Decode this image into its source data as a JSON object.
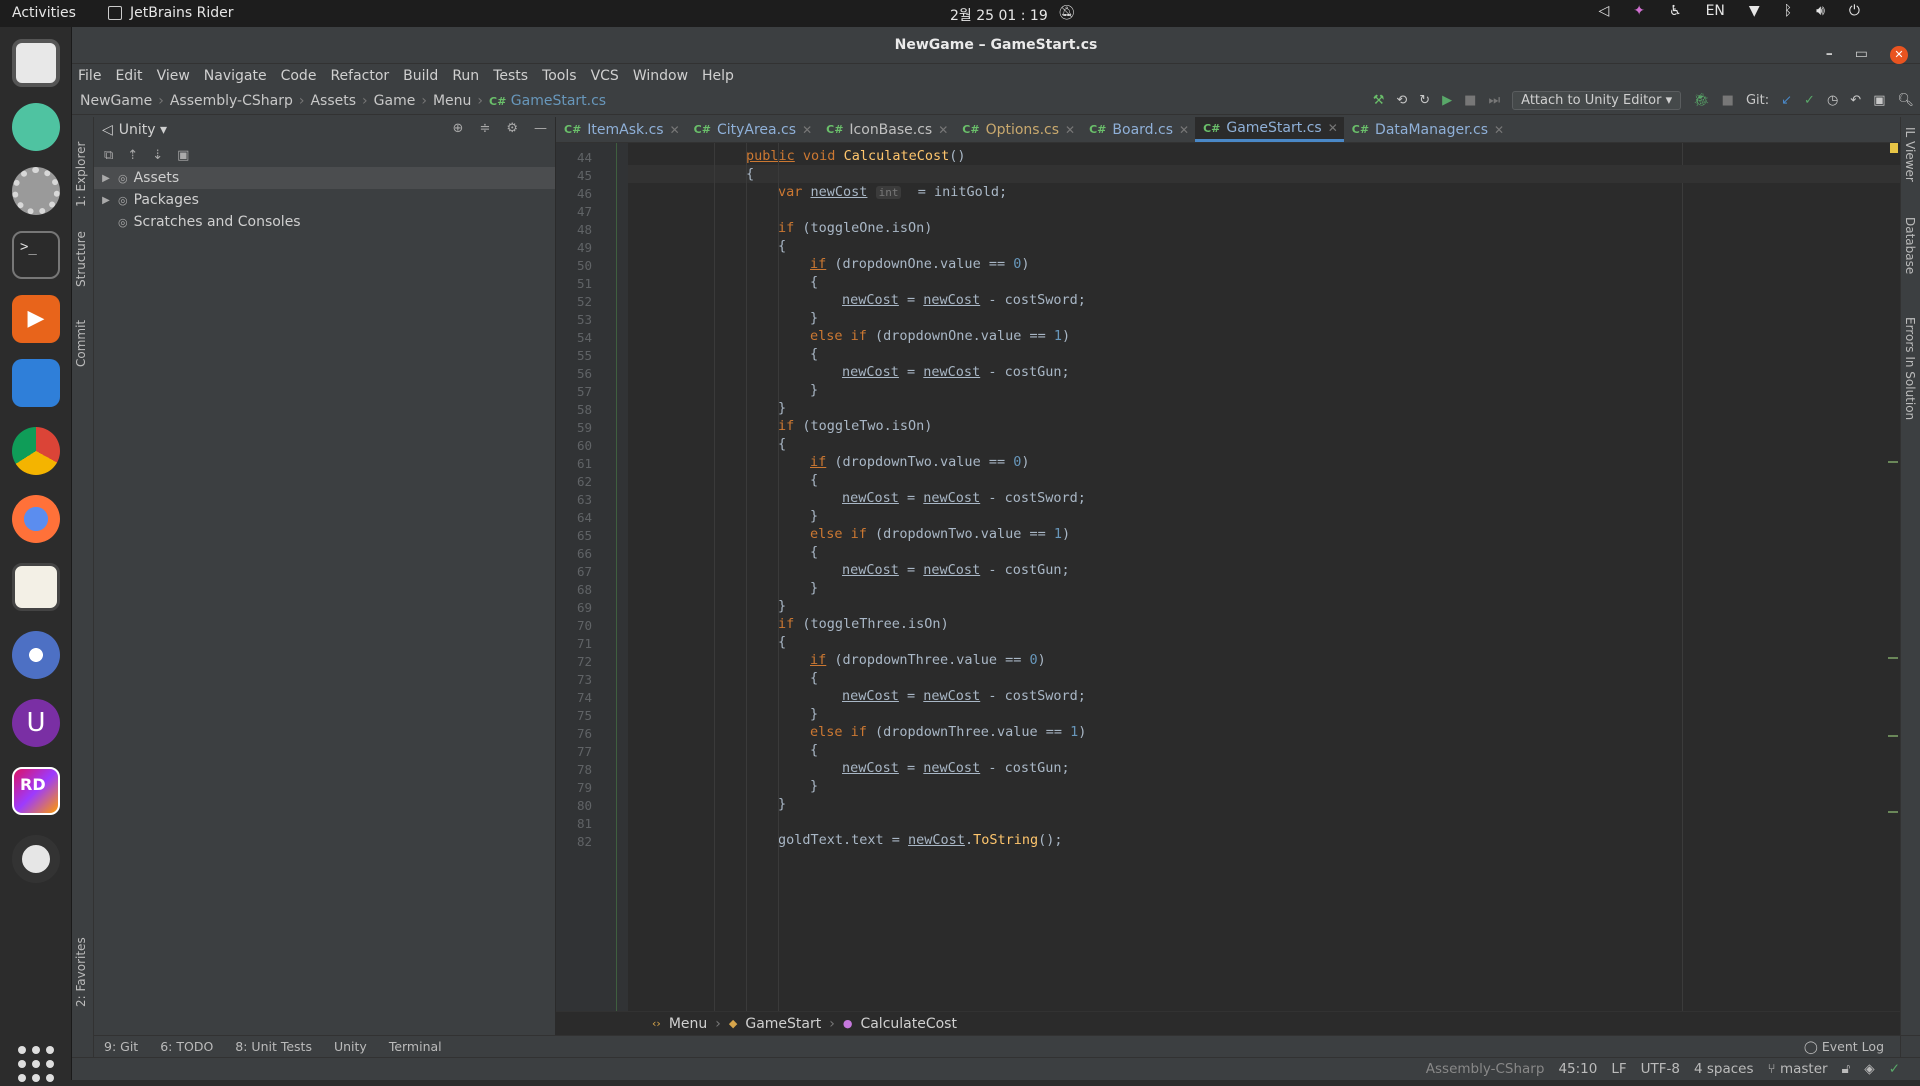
{
  "topbar": {
    "activities": "Activities",
    "app_name": "JetBrains Rider",
    "clock": "2월 25 01 : 19",
    "lang": "EN"
  },
  "window": {
    "title": "NewGame – GameStart.cs"
  },
  "menu": [
    "File",
    "Edit",
    "View",
    "Navigate",
    "Code",
    "Refactor",
    "Build",
    "Run",
    "Tests",
    "Tools",
    "VCS",
    "Window",
    "Help"
  ],
  "nav": {
    "crumbs": [
      "NewGame",
      "Assembly-CSharp",
      "Assets",
      "Game",
      "Menu"
    ],
    "current": "GameStart.cs",
    "attach_label": "Attach to Unity Editor",
    "git_label": "Git:"
  },
  "left_strip": {
    "explorer": "1: Explorer",
    "structure": "Structure",
    "commit": "Commit",
    "favorites": "2: Favorites"
  },
  "right_strip": {
    "il_viewer": "IL Viewer",
    "database": "Database",
    "errors": "Errors In Solution"
  },
  "explorer": {
    "scope": "Unity",
    "items": [
      {
        "label": "Assets",
        "expandable": true,
        "selected": true
      },
      {
        "label": "Packages",
        "expandable": true,
        "selected": false
      },
      {
        "label": "Scratches and Consoles",
        "expandable": false,
        "selected": false
      }
    ]
  },
  "tabs": [
    {
      "label": "ItemAsk.cs",
      "style": "mod2"
    },
    {
      "label": "CityArea.cs",
      "style": "mod2"
    },
    {
      "label": "IconBase.cs",
      "style": "normal"
    },
    {
      "label": "Options.cs",
      "style": "mod"
    },
    {
      "label": "Board.cs",
      "style": "mod2"
    },
    {
      "label": "GameStart.cs",
      "style": "active"
    },
    {
      "label": "DataManager.cs",
      "style": "mod2"
    }
  ],
  "code": [
    {
      "n": "44",
      "indent": 2,
      "html": "<span class=\"kw2\">public</span> <span class=\"kw\">void</span> <span class=\"fn\">CalculateCost</span>()"
    },
    {
      "n": "45",
      "indent": 2,
      "html": "{",
      "current": true
    },
    {
      "n": "46",
      "indent": 3,
      "html": "<span class=\"kw\">var</span> <span class=\"var\">newCost</span> <span class=\"hint\">int</span>  = initGold;"
    },
    {
      "n": "47",
      "indent": 0,
      "html": ""
    },
    {
      "n": "48",
      "indent": 3,
      "html": "<span class=\"kw\">if</span> (toggleOne.isOn)"
    },
    {
      "n": "49",
      "indent": 3,
      "html": "{"
    },
    {
      "n": "50",
      "indent": 4,
      "html": "<span class=\"kw2\">if</span> (dropdownOne.value == <span class=\"num\">0</span>)"
    },
    {
      "n": "51",
      "indent": 4,
      "html": "{"
    },
    {
      "n": "52",
      "indent": 5,
      "html": "<span class=\"var\">newCost</span> = <span class=\"var\">newCost</span> - costSword;"
    },
    {
      "n": "53",
      "indent": 4,
      "html": "}"
    },
    {
      "n": "54",
      "indent": 4,
      "html": "<span class=\"kw\">else if</span> (dropdownOne.value == <span class=\"num\">1</span>)"
    },
    {
      "n": "55",
      "indent": 4,
      "html": "{"
    },
    {
      "n": "56",
      "indent": 5,
      "html": "<span class=\"var\">newCost</span> = <span class=\"var\">newCost</span> - costGun;"
    },
    {
      "n": "57",
      "indent": 4,
      "html": "}"
    },
    {
      "n": "58",
      "indent": 3,
      "html": "}"
    },
    {
      "n": "59",
      "indent": 3,
      "html": "<span class=\"kw\">if</span> (toggleTwo.isOn)"
    },
    {
      "n": "60",
      "indent": 3,
      "html": "{"
    },
    {
      "n": "61",
      "indent": 4,
      "html": "<span class=\"kw2\">if</span> (dropdownTwo.value == <span class=\"num\">0</span>)"
    },
    {
      "n": "62",
      "indent": 4,
      "html": "{"
    },
    {
      "n": "63",
      "indent": 5,
      "html": "<span class=\"var\">newCost</span> = <span class=\"var\">newCost</span> - costSword;"
    },
    {
      "n": "64",
      "indent": 4,
      "html": "}"
    },
    {
      "n": "65",
      "indent": 4,
      "html": "<span class=\"kw\">else if</span> (dropdownTwo.value == <span class=\"num\">1</span>)"
    },
    {
      "n": "66",
      "indent": 4,
      "html": "{"
    },
    {
      "n": "67",
      "indent": 5,
      "html": "<span class=\"var\">newCost</span> = <span class=\"var\">newCost</span> - costGun;"
    },
    {
      "n": "68",
      "indent": 4,
      "html": "}"
    },
    {
      "n": "69",
      "indent": 3,
      "html": "}"
    },
    {
      "n": "70",
      "indent": 3,
      "html": "<span class=\"kw\">if</span> (toggleThree.isOn)"
    },
    {
      "n": "71",
      "indent": 3,
      "html": "{"
    },
    {
      "n": "72",
      "indent": 4,
      "html": "<span class=\"kw2\">if</span> (dropdownThree.value == <span class=\"num\">0</span>)"
    },
    {
      "n": "73",
      "indent": 4,
      "html": "{"
    },
    {
      "n": "74",
      "indent": 5,
      "html": "<span class=\"var\">newCost</span> = <span class=\"var\">newCost</span> - costSword;"
    },
    {
      "n": "75",
      "indent": 4,
      "html": "}"
    },
    {
      "n": "76",
      "indent": 4,
      "html": "<span class=\"kw\">else if</span> (dropdownThree.value == <span class=\"num\">1</span>)"
    },
    {
      "n": "77",
      "indent": 4,
      "html": "{"
    },
    {
      "n": "78",
      "indent": 5,
      "html": "<span class=\"var\">newCost</span> = <span class=\"var\">newCost</span> - costGun;"
    },
    {
      "n": "79",
      "indent": 4,
      "html": "}"
    },
    {
      "n": "80",
      "indent": 3,
      "html": "}"
    },
    {
      "n": "81",
      "indent": 0,
      "html": ""
    },
    {
      "n": "82",
      "indent": 3,
      "html": "goldText.text = <span class=\"var\">newCost</span>.<span class=\"fn\">ToString</span>();"
    }
  ],
  "breadcrumb": [
    "Menu",
    "GameStart",
    "CalculateCost"
  ],
  "bottom_tabs": [
    "9: Git",
    "6: TODO",
    "8: Unit Tests",
    "Unity",
    "Terminal"
  ],
  "event_log": "Event Log",
  "status": {
    "project": "Assembly-CSharp",
    "position": "45:10",
    "line_sep": "LF",
    "encoding": "UTF-8",
    "indent": "4 spaces",
    "branch": "master"
  }
}
